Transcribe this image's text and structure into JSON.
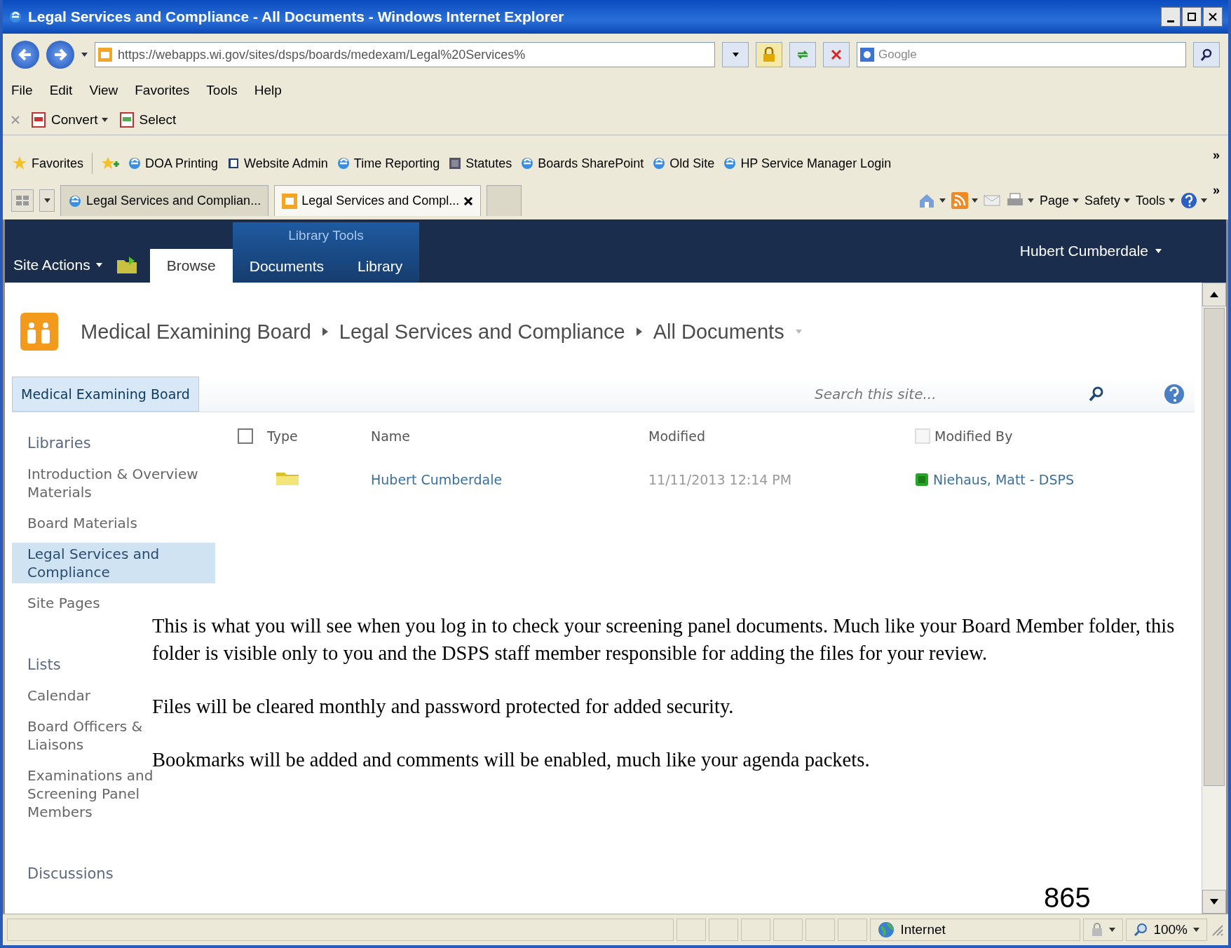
{
  "window": {
    "title": "Legal Services and Compliance - All Documents - Windows Internet Explorer"
  },
  "address_bar": {
    "url": "https://webapps.wi.gov/sites/dsps/boards/medexam/Legal%20Services%",
    "search_placeholder": "Google"
  },
  "menu_bar": [
    "File",
    "Edit",
    "View",
    "Favorites",
    "Tools",
    "Help"
  ],
  "command_bar": [
    "Convert",
    "Select"
  ],
  "favorites_bar": {
    "label": "Favorites",
    "overflow": "»",
    "items": [
      "DOA Printing",
      "Website Admin",
      "Time Reporting",
      "Statutes",
      "Boards SharePoint",
      "Old Site",
      "HP Service Manager Login"
    ]
  },
  "browser_tabs": [
    {
      "label": "Legal Services and Complian...",
      "selected": false
    },
    {
      "label": "Legal Services and Compl...",
      "selected": true
    }
  ],
  "tab_tools": [
    "Page",
    "Safety",
    "Tools"
  ],
  "tab_tools_overflow": "»",
  "ribbon": {
    "site_actions": "Site Actions",
    "contextual_group": "Library Tools",
    "user": "Hubert Cumberdale",
    "tabs": [
      {
        "label": "Browse",
        "selected": true
      },
      {
        "label": "Documents",
        "selected": false
      },
      {
        "label": "Library",
        "selected": false
      }
    ]
  },
  "breadcrumb": [
    "Medical Examining Board",
    "Legal Services and Compliance",
    "All Documents"
  ],
  "top_nav": {
    "site": "Medical Examining Board",
    "search_placeholder": "Search this site..."
  },
  "sidebar": {
    "sections": [
      {
        "heading": "Libraries",
        "items": [
          {
            "label": "Introduction & Overview Materials",
            "selected": false
          },
          {
            "label": "Board Materials",
            "selected": false
          },
          {
            "label": "Legal Services and Compliance",
            "selected": true
          },
          {
            "label": "Site Pages",
            "selected": false
          }
        ]
      },
      {
        "heading": "Lists",
        "items": [
          {
            "label": "Calendar",
            "selected": false
          },
          {
            "label": "Board Officers & Liaisons",
            "selected": false
          },
          {
            "label": "Examinations and Screening Panel Members",
            "selected": false
          }
        ]
      },
      {
        "heading": "Discussions"
      }
    ]
  },
  "table": {
    "select_all_checked": false,
    "columns": [
      "Type",
      "Name",
      "Modified",
      "Modified By"
    ],
    "rows": [
      {
        "name": "Hubert Cumberdale",
        "modified": "11/11/2013 12:14 PM",
        "modified_by": "Niehaus, Matt - DSPS"
      }
    ]
  },
  "annotation": {
    "paragraphs": [
      "This is what you will see when you log in to check your screening panel documents. Much like your Board Member folder, this folder is visible only to you and the DSPS staff member responsible for adding the files for your review.",
      "Files will be cleared monthly and password protected for added security.",
      "Bookmarks will be added and comments will be enabled, much like your agenda packets."
    ]
  },
  "page_number": "865",
  "status_bar": {
    "zone": "Internet",
    "zoom": "100%"
  }
}
